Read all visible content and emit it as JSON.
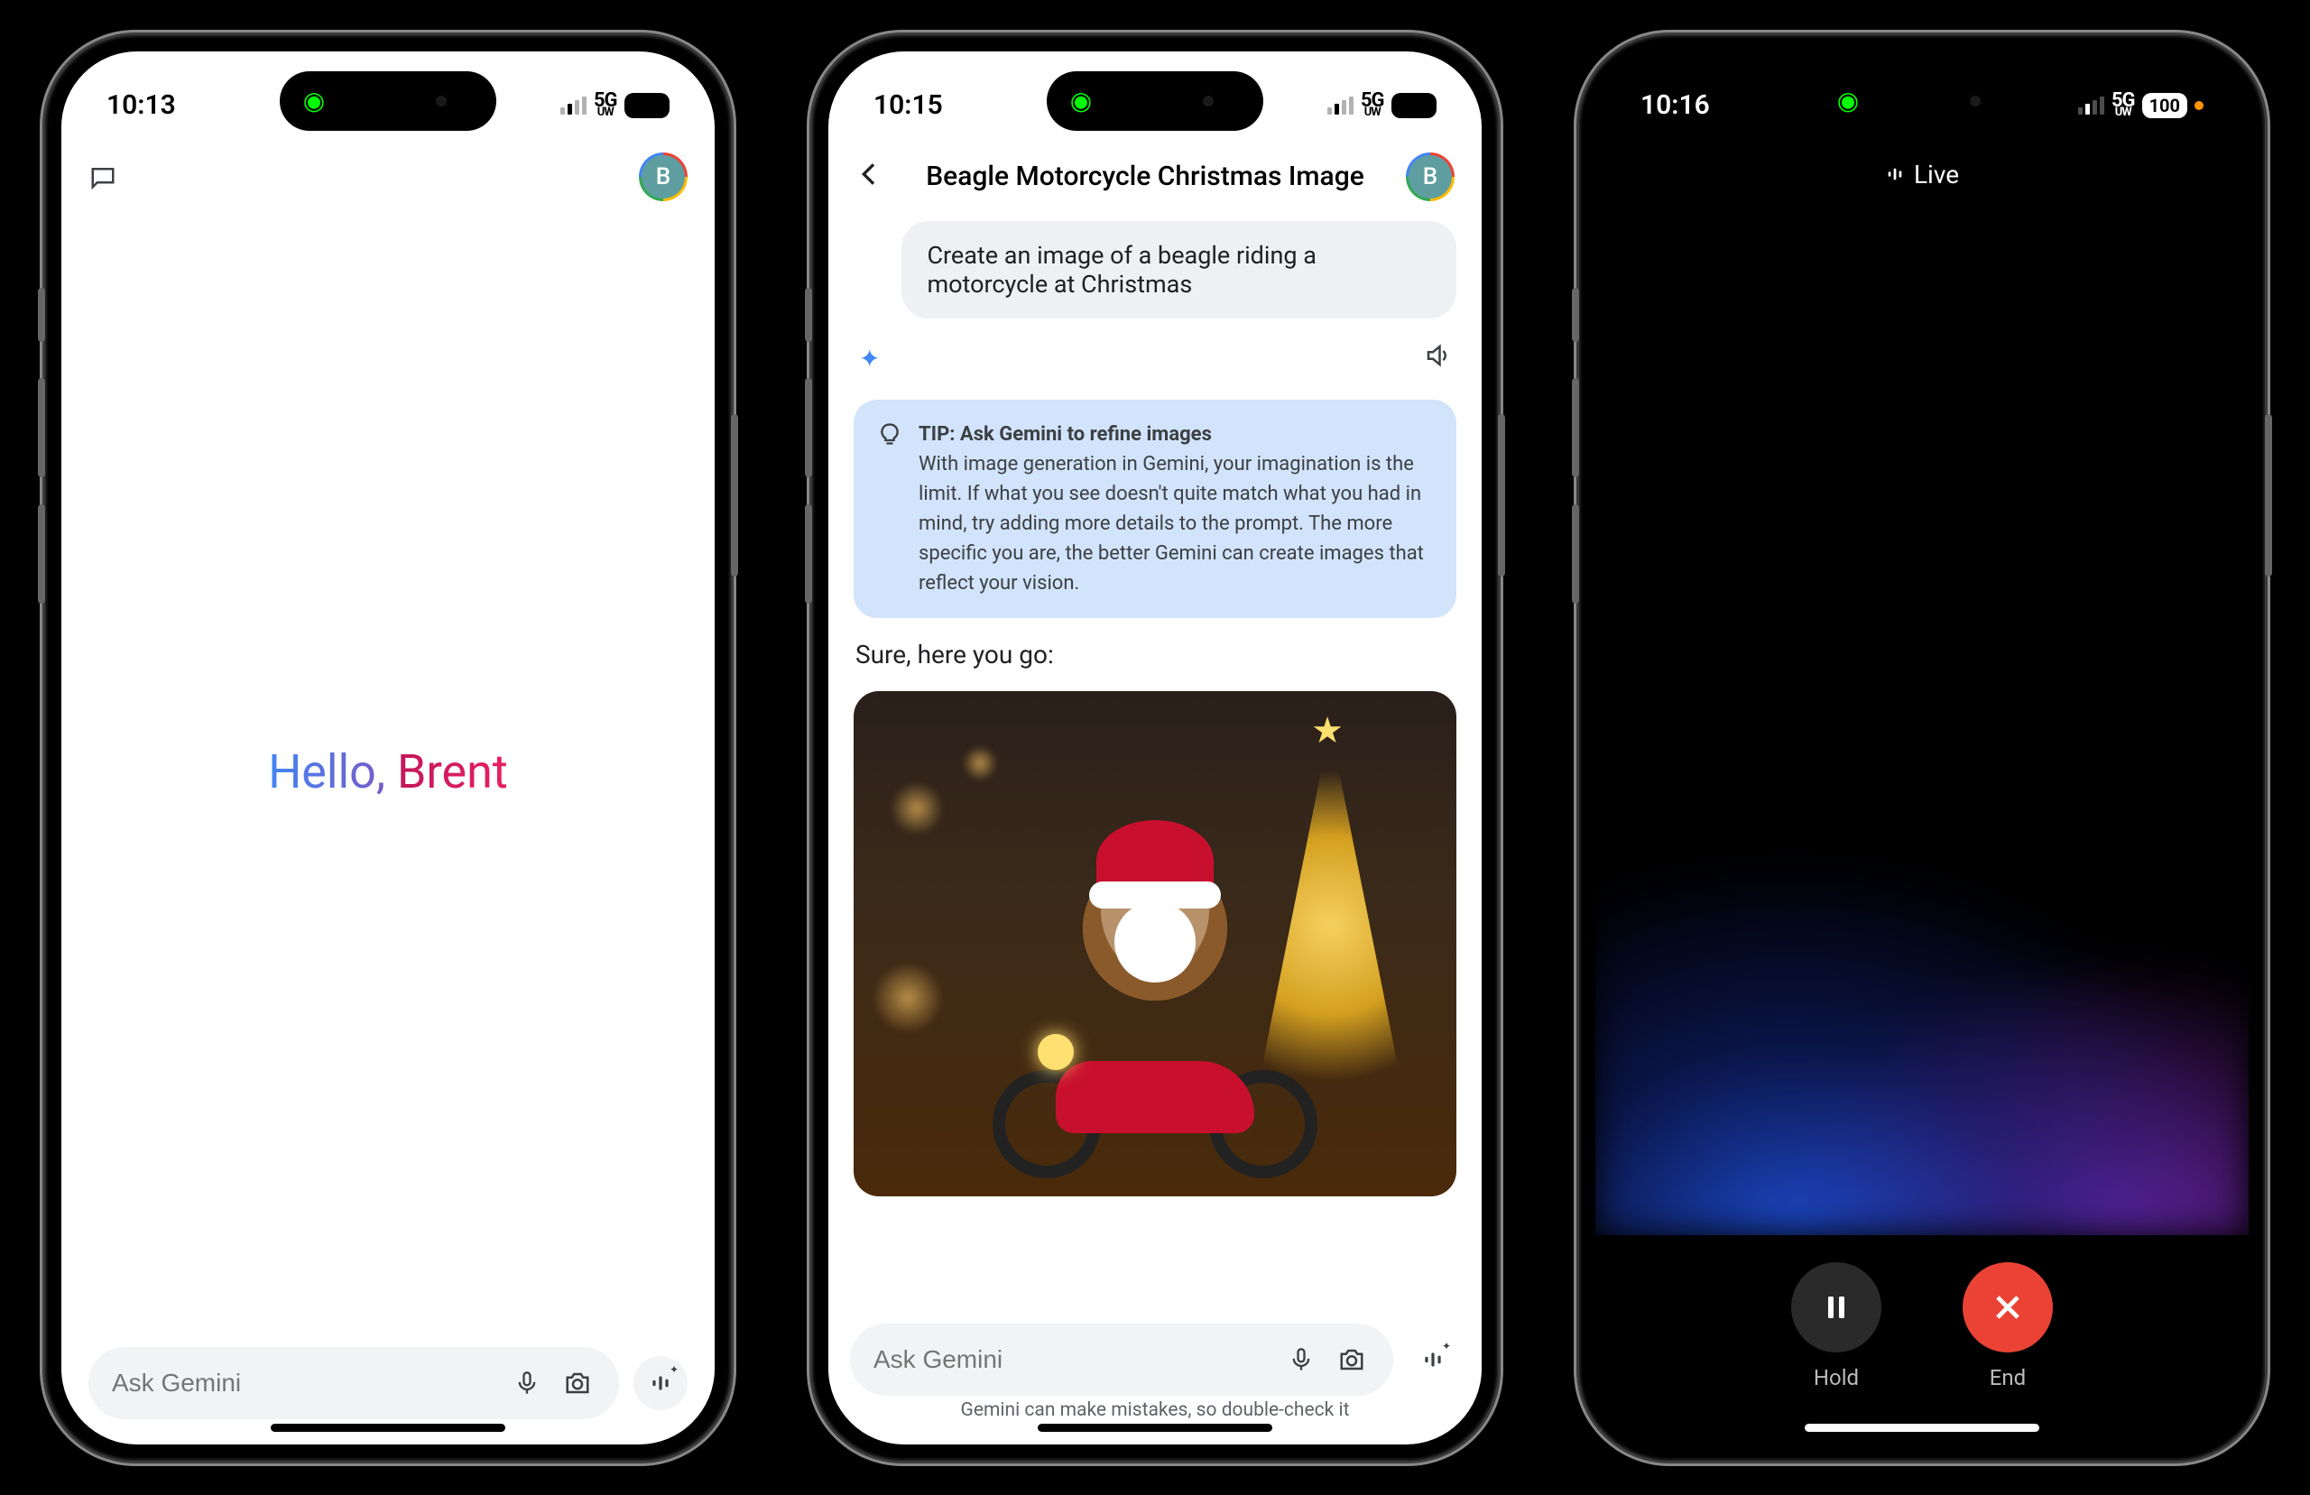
{
  "phone1": {
    "time": "10:13",
    "network": "5G",
    "network_sub": "UW",
    "battery": "100",
    "avatar_initial": "B",
    "greeting_hello": "Hello, ",
    "greeting_name": "Brent",
    "input_placeholder": "Ask Gemini"
  },
  "phone2": {
    "time": "10:15",
    "network": "5G",
    "network_sub": "UW",
    "battery": "100",
    "avatar_initial": "B",
    "title": "Beagle Motorcycle Christmas Image",
    "user_message": "Create an image of a beagle riding a motorcycle at Christmas",
    "tip_heading": "TIP: Ask Gemini to refine images",
    "tip_body": "With image generation in Gemini, your imagination is the limit. If what you see doesn't quite match what you had in mind, try adding more details to the prompt. The more specific you are, the better Gemini can create images that reflect your vision.",
    "reply": "Sure, here you go:",
    "input_placeholder": "Ask Gemini",
    "disclaimer": "Gemini can make mistakes, so double-check it"
  },
  "phone3": {
    "time": "10:16",
    "network": "5G",
    "network_sub": "UW",
    "battery": "100",
    "live_label": "Live",
    "hold_label": "Hold",
    "end_label": "End"
  }
}
